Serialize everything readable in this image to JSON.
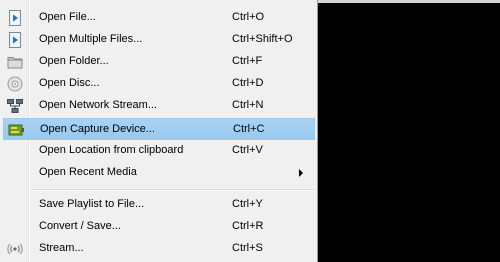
{
  "menu": {
    "items": [
      {
        "label": "Open File...",
        "shortcut": "Ctrl+O",
        "icon": "play-file-icon"
      },
      {
        "label": "Open Multiple Files...",
        "shortcut": "Ctrl+Shift+O",
        "icon": "play-files-icon"
      },
      {
        "label": "Open Folder...",
        "shortcut": "Ctrl+F",
        "icon": "folder-icon"
      },
      {
        "label": "Open Disc...",
        "shortcut": "Ctrl+D",
        "icon": "disc-icon"
      },
      {
        "label": "Open Network Stream...",
        "shortcut": "Ctrl+N",
        "icon": "network-icon"
      },
      {
        "label": "Open Capture Device...",
        "shortcut": "Ctrl+C",
        "icon": "capture-card-icon",
        "highlighted": true
      },
      {
        "label": "Open Location from clipboard",
        "shortcut": "Ctrl+V",
        "icon": ""
      },
      {
        "label": "Open Recent Media",
        "shortcut": "",
        "icon": "",
        "submenu": true
      },
      {
        "label": "Save Playlist to File...",
        "shortcut": "Ctrl+Y",
        "icon": ""
      },
      {
        "label": "Convert / Save...",
        "shortcut": "Ctrl+R",
        "icon": ""
      },
      {
        "label": "Stream...",
        "shortcut": "Ctrl+S",
        "icon": "stream-icon"
      }
    ]
  },
  "colors": {
    "highlight": "#99c9ef",
    "menu_bg": "#f0f0f0",
    "player_bg": "#000000"
  }
}
